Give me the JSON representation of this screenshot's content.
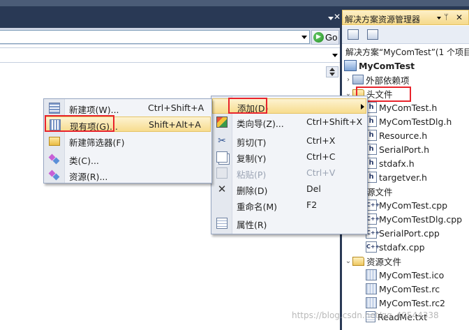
{
  "editor": {
    "go_label": "Go",
    "go_glyph": "▶",
    "close_glyph": "✕"
  },
  "solution_explorer": {
    "title": "解决方案资源管理器",
    "pin_glyph": "ᛘ",
    "close_glyph": "✕",
    "header": "解决方案“MyComTest”(1 个项目",
    "project": "MyComTest",
    "nodes": [
      {
        "label": "外部依赖项",
        "type": "external",
        "expander": "›"
      },
      {
        "label": "头文件",
        "type": "folder-open",
        "expander": "⌄"
      },
      {
        "label": "MyComTest.h",
        "type": "h"
      },
      {
        "label": "MyComTestDlg.h",
        "type": "h"
      },
      {
        "label": "Resource.h",
        "type": "h"
      },
      {
        "label": "SerialPort.h",
        "type": "h"
      },
      {
        "label": "stdafx.h",
        "type": "h"
      },
      {
        "label": "targetver.h",
        "type": "h"
      },
      {
        "label": "源文件",
        "type": "folder"
      },
      {
        "label": "MyComTest.cpp",
        "type": "cpp"
      },
      {
        "label": "MyComTestDlg.cpp",
        "type": "cpp"
      },
      {
        "label": "SerialPort.cpp",
        "type": "cpp"
      },
      {
        "label": "stdafx.cpp",
        "type": "cpp"
      },
      {
        "label": "资源文件",
        "type": "folder-open",
        "expander": "⌄"
      },
      {
        "label": "MyComTest.ico",
        "type": "res"
      },
      {
        "label": "MyComTest.rc",
        "type": "res"
      },
      {
        "label": "MyComTest.rc2",
        "type": "res"
      },
      {
        "label": "ReadMe.txt",
        "type": "txt"
      }
    ],
    "icon_text": {
      "h": "h",
      "cpp": "C++"
    }
  },
  "main_menu": {
    "items": [
      {
        "label": "添加(D)",
        "shortcut": "",
        "icon": "none",
        "submenu": true,
        "highlighted": true
      },
      {
        "label": "类向导(Z)...",
        "shortcut": "Ctrl+Shift+X",
        "icon": "wizard-icon"
      },
      {
        "label": "剪切(T)",
        "shortcut": "Ctrl+X",
        "icon": "cut-icon"
      },
      {
        "label": "复制(Y)",
        "shortcut": "Ctrl+C",
        "icon": "copy-icon"
      },
      {
        "label": "粘贴(P)",
        "shortcut": "Ctrl+V",
        "icon": "paste-icon",
        "disabled": true
      },
      {
        "label": "删除(D)",
        "shortcut": "Del",
        "icon": "delete-icon"
      },
      {
        "label": "重命名(M)",
        "shortcut": "F2",
        "icon": "none"
      },
      {
        "label": "属性(R)",
        "shortcut": "",
        "icon": "properties-icon"
      }
    ],
    "cut_glyph": "✂",
    "delete_glyph": "✕"
  },
  "add_submenu": {
    "items": [
      {
        "label": "新建项(W)...",
        "shortcut": "Ctrl+Shift+A",
        "icon": "new-item-icon"
      },
      {
        "label": "现有项(G)...",
        "shortcut": "Shift+Alt+A",
        "icon": "existing-item-icon",
        "highlighted": true
      },
      {
        "label": "新建筛选器(F)",
        "shortcut": "",
        "icon": "folder-icon"
      },
      {
        "label": "类(C)...",
        "shortcut": "",
        "icon": "class-icon"
      },
      {
        "label": "资源(R)...",
        "shortcut": "",
        "icon": "resource-icon"
      }
    ]
  },
  "watermark": "https://blog.csdn.net/qq_40544338",
  "colors": {
    "highlight_border": "#e8232b",
    "menu_hover": "#f7dc8e",
    "chrome_dark": "#293955"
  }
}
